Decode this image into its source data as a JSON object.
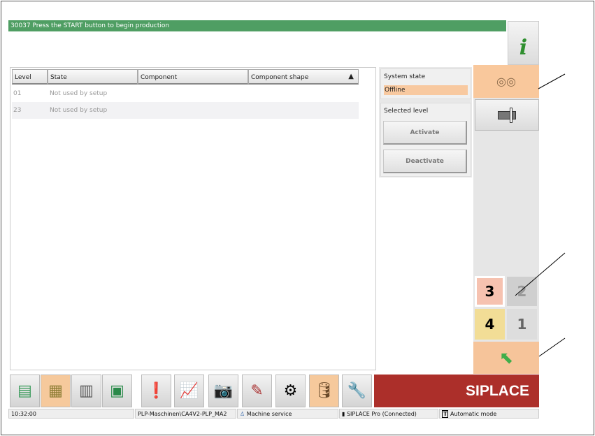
{
  "message": "30037 Press the START button to begin production",
  "table": {
    "headers": [
      "Level",
      "State",
      "Component",
      "Component shape"
    ],
    "rows": [
      {
        "level": "01",
        "state": "Not used by setup"
      },
      {
        "level": "23",
        "state": "Not used by setup"
      }
    ]
  },
  "panel": {
    "system_state_label": "System state",
    "system_state_value": "Offline",
    "selected_level_label": "Selected level",
    "activate": "Activate",
    "deactivate": "Deactivate"
  },
  "levels": {
    "l3": "3",
    "l2": "2",
    "l4": "4",
    "l1": "1"
  },
  "brand": "SIPLACE",
  "status": {
    "time": "10:32:00",
    "path": "PLP-Maschinen\\CA4V2-PLP_MA2",
    "user": "Machine service",
    "connection": "SIPLACE Pro (Connected)",
    "mode": "Automatic mode"
  }
}
